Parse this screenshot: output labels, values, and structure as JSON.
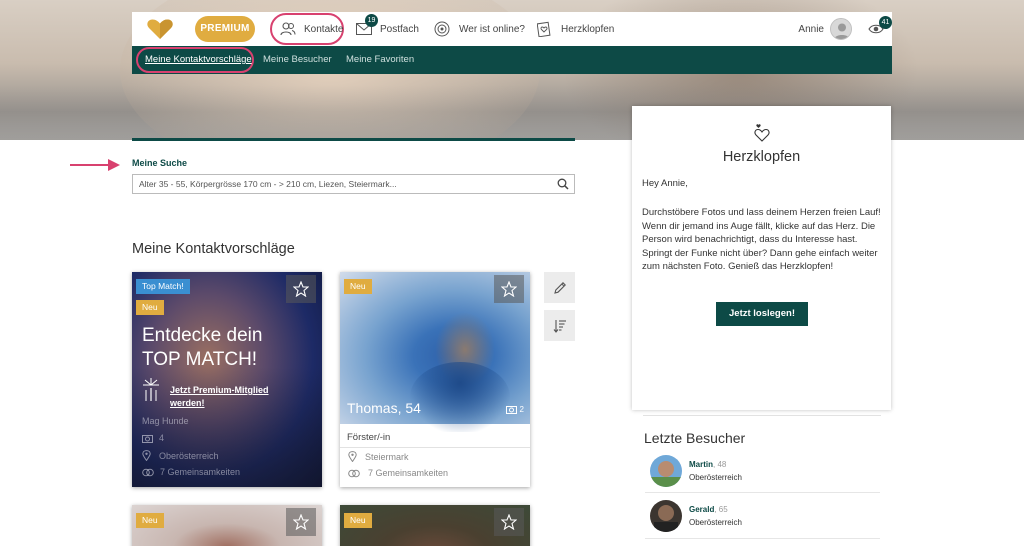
{
  "nav": {
    "premium_label": "PREMIUM",
    "kontakte_label": "Kontakte",
    "postfach_label": "Postfach",
    "postfach_badge": "19",
    "online_label": "Wer ist online?",
    "herzklopfen_label": "Herzklopfen",
    "user_name": "Annie",
    "visitors_badge": "41"
  },
  "subnav": {
    "items": [
      "Meine Kontaktvorschläge",
      "Meine Besucher",
      "Meine Favoriten"
    ]
  },
  "search": {
    "label": "Meine Suche",
    "value": "Alter 35 - 55, Körpergrösse 170 cm - > 210 cm, Liezen, Steiermark..."
  },
  "section_title": "Meine Kontaktvorschläge",
  "cards": [
    {
      "tags": [
        "Top Match!",
        "Neu"
      ],
      "headline_1": "Entdecke dein",
      "headline_2": "TOP MATCH!",
      "premium_link": "Jetzt Premium-Mitglied werden!",
      "name": "Mag Hunde",
      "photos": "4",
      "location": "Oberösterreich",
      "common": "7 Gemeinsamkeiten"
    },
    {
      "tags": [
        "Neu"
      ],
      "name": "Thomas, 54",
      "photos": "2",
      "job": "Förster/-in",
      "location": "Steiermark",
      "common": "7 Gemeinsamkeiten"
    },
    {
      "tags": [
        "Neu"
      ]
    },
    {
      "tags": [
        "Neu"
      ]
    }
  ],
  "panel": {
    "title": "Herzklopfen",
    "greeting": "Hey Annie,",
    "text": "Durchstöbere Fotos und lass deinem Herzen freien Lauf! Wenn dir jemand ins Auge fällt, klicke auf das Herz. Die Person wird benachrichtigt, dass du Interesse hast. Springt der Funke nicht über? Dann gehe einfach weiter zum nächsten Foto. Genieß das Herzklopfen!",
    "button": "Jetzt loslegen!"
  },
  "last_visitors": {
    "title": "Letzte Besucher",
    "items": [
      {
        "name": "Martin",
        "age": ", 48",
        "region": "Oberösterreich"
      },
      {
        "name": "Gerald",
        "age": ", 65",
        "region": "Oberösterreich"
      }
    ]
  },
  "colors": {
    "brand_green": "#0d4a46",
    "premium_gold": "#e0ac40",
    "highlight_pink": "#d8416f",
    "tag_blue": "#3a8fd1"
  }
}
